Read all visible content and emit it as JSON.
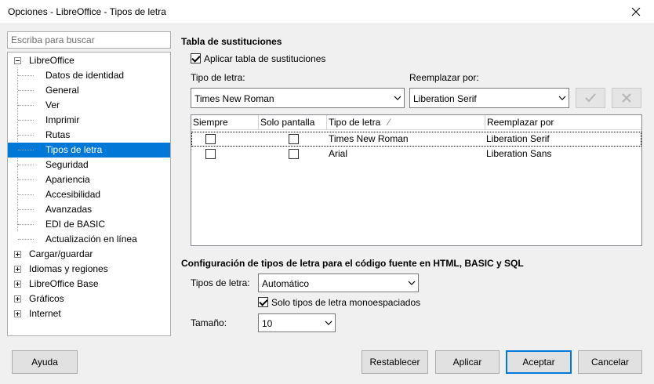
{
  "window": {
    "title": "Opciones - LibreOffice - Tipos de letra"
  },
  "search": {
    "placeholder": "Escriba para buscar"
  },
  "tree": {
    "root": "LibreOffice",
    "children": [
      "Datos de identidad",
      "General",
      "Ver",
      "Imprimir",
      "Rutas",
      "Tipos de letra",
      "Seguridad",
      "Apariencia",
      "Accesibilidad",
      "Avanzadas",
      "EDI de BASIC",
      "Actualización en línea"
    ],
    "selected": "Tipos de letra",
    "groups": [
      "Cargar/guardar",
      "Idiomas y regiones",
      "LibreOffice Base",
      "Gráficos",
      "Internet"
    ]
  },
  "replacement": {
    "title": "Tabla de sustituciones",
    "apply_label": "Aplicar tabla de sustituciones",
    "apply_checked": true,
    "font_label": "Tipo de letra:",
    "font_value": "Times New Roman",
    "replace_label": "Reemplazar por:",
    "replace_value": "Liberation Serif",
    "columns": [
      "Siempre",
      "Solo pantalla",
      "Tipo de letra",
      "Reemplazar por"
    ],
    "sort_indicator": "⁄",
    "rows": [
      {
        "always": false,
        "screen": false,
        "font": "Times New Roman",
        "replace": "Liberation Serif"
      },
      {
        "always": false,
        "screen": false,
        "font": "Arial",
        "replace": "Liberation Sans"
      }
    ]
  },
  "source": {
    "title": "Configuración de tipos de letra para el código fuente en HTML, BASIC y SQL",
    "fonts_label": "Tipos de letra:",
    "fonts_value": "Automático",
    "mono_label": "Solo tipos de letra monoespaciados",
    "mono_checked": true,
    "size_label": "Tamaño:",
    "size_value": "10"
  },
  "buttons": {
    "help": "Ayuda",
    "reset": "Restablecer",
    "apply": "Aplicar",
    "ok": "Aceptar",
    "cancel": "Cancelar"
  },
  "colors": {
    "selection": "#0078d7",
    "accent_border": "#0078d7"
  }
}
